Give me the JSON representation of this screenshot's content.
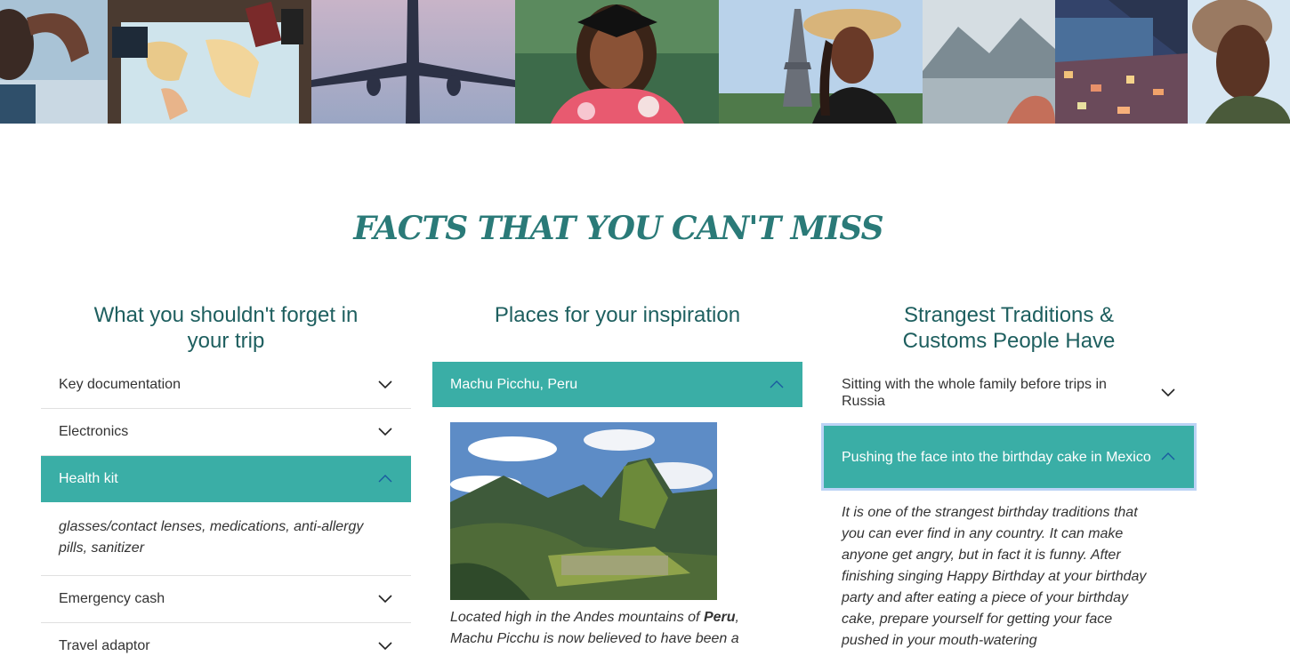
{
  "photos": [
    {
      "name": "woman-looking-photo",
      "alt": "woman shading eyes"
    },
    {
      "name": "world-map-photo",
      "alt": "world map with passport"
    },
    {
      "name": "airplane-photo",
      "alt": "airplane in sky"
    },
    {
      "name": "graduate-photo",
      "alt": "smiling graduate"
    },
    {
      "name": "eiffel-tower-photo",
      "alt": "woman at Eiffel Tower"
    },
    {
      "name": "lake-mountains-photo",
      "alt": "lake and mountains"
    },
    {
      "name": "coastal-town-photo",
      "alt": "coastal town at night"
    },
    {
      "name": "woman-hat-photo",
      "alt": "woman in hat"
    }
  ],
  "main_title": "FACTS THAT YOU CAN'T MISS",
  "col1": {
    "title": "What you shouldn't forget in your trip",
    "items": [
      {
        "label": "Key documentation",
        "open": false
      },
      {
        "label": "Electronics",
        "open": false
      },
      {
        "label": "Health kit",
        "open": true,
        "body": "glasses/contact lenses, medications, anti-allergy pills, sanitizer"
      },
      {
        "label": "Emergency cash",
        "open": false
      },
      {
        "label": "Travel adaptor",
        "open": false
      }
    ]
  },
  "col2": {
    "title": "Places for your inspiration",
    "items": [
      {
        "label": "Machu Picchu, Peru",
        "open": true,
        "image": "Machu Picchu mountain ruins",
        "body_prefix": "Located high in the Andes mountains of ",
        "body_bold": "Peru",
        "body_suffix": ", Machu Picchu is now believed to have been a"
      }
    ]
  },
  "col3": {
    "title": "Strangest Traditions & Customs People Have",
    "items": [
      {
        "label": "Sitting with the whole family before trips in Russia",
        "open": false
      },
      {
        "label": "Pushing the face into the birthday cake in Mexico",
        "open": true,
        "body": "It is one of the strangest birthday traditions that you can ever find in any country. It can make anyone get angry, but in fact it is funny. After finishing singing Happy Birthday at your birthday party and after eating a piece of your birthday cake, prepare yourself for getting your face pushed in your mouth-watering"
      }
    ]
  },
  "colors": {
    "accent": "#3aaea6",
    "title": "#2a7a78",
    "heading": "#1e5f5f"
  },
  "icons": {
    "collapsed": "chevron-down-icon",
    "expanded": "chevron-up-icon"
  }
}
